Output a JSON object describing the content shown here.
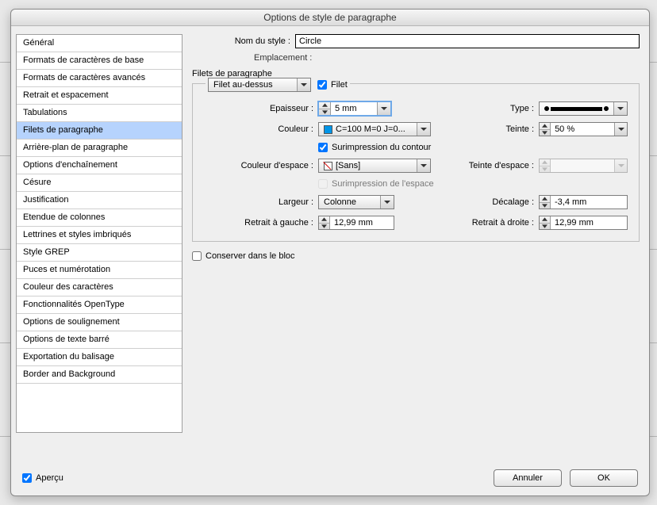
{
  "window_title": "Options de style de paragraphe",
  "sidebar": {
    "items": [
      "Général",
      "Formats de caractères de base",
      "Formats de caractères avancés",
      "Retrait et espacement",
      "Tabulations",
      "Filets de paragraphe",
      "Arrière-plan de paragraphe",
      "Options d'enchaînement",
      "Césure",
      "Justification",
      "Etendue de colonnes",
      "Lettrines et styles imbriqués",
      "Style GREP",
      "Puces et numérotation",
      "Couleur des caractères",
      "Fonctionnalités OpenType",
      "Options de soulignement",
      "Options de texte barré",
      "Exportation du balisage",
      "Border and Background"
    ],
    "selected_index": 5
  },
  "header": {
    "style_name_label": "Nom du style :",
    "style_name_value": "Circle",
    "location_label": "Emplacement :"
  },
  "section_title": "Filets de paragraphe",
  "group": {
    "rule_select": "Filet au-dessus",
    "enable_label": "Filet",
    "thickness_label": "Epaisseur :",
    "thickness_value": "5 mm",
    "type_label": "Type :",
    "color_label": "Couleur :",
    "color_value": "C=100 M=0 J=0...",
    "tint_label": "Teinte :",
    "tint_value": "50 %",
    "overprint_stroke": "Surimpression du contour",
    "gap_color_label": "Couleur d'espace :",
    "gap_color_value": "[Sans]",
    "gap_tint_label": "Teinte d'espace :",
    "overprint_gap": "Surimpression de l'espace",
    "width_label": "Largeur :",
    "width_value": "Colonne",
    "offset_label": "Décalage :",
    "offset_value": "-3,4 mm",
    "left_indent_label": "Retrait à gauche :",
    "left_indent_value": "12,99 mm",
    "right_indent_label": "Retrait à droite :",
    "right_indent_value": "12,99 mm",
    "keep_in_frame": "Conserver dans le bloc"
  },
  "footer": {
    "preview": "Aperçu",
    "cancel": "Annuler",
    "ok": "OK"
  }
}
